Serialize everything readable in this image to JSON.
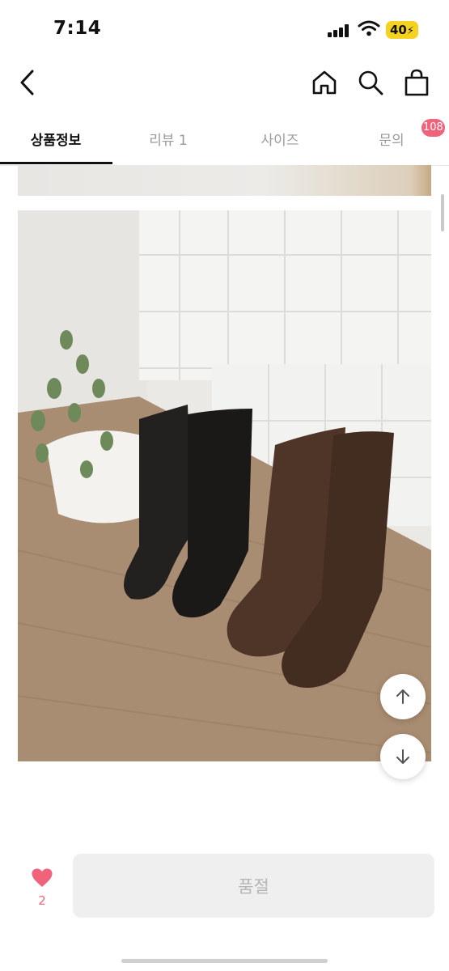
{
  "status_bar": {
    "time": "7:14",
    "battery": "40",
    "icons": [
      "cellular-signal-icon",
      "wifi-icon",
      "battery-charging-icon"
    ]
  },
  "header": {
    "icons": [
      "back-chevron-icon",
      "home-icon",
      "search-icon",
      "shopping-bag-icon"
    ],
    "cart_count": "108"
  },
  "tabs": [
    {
      "label": "상품정보",
      "active": true
    },
    {
      "label": "리뷰 1",
      "active": false
    },
    {
      "label": "사이즈",
      "active": false
    },
    {
      "label": "문의",
      "active": false
    }
  ],
  "floating_buttons": {
    "scroll_top_icon": "arrow-up-icon",
    "scroll_down_icon": "arrow-down-icon"
  },
  "bottom_bar": {
    "like_icon": "heart-icon",
    "like_count": "2",
    "purchase_button_label": "품절"
  },
  "colors": {
    "accent": "#f0637a",
    "battery": "#f4d21f",
    "disabled_button_bg": "#efefef",
    "disabled_button_text": "#b5b5b5"
  }
}
